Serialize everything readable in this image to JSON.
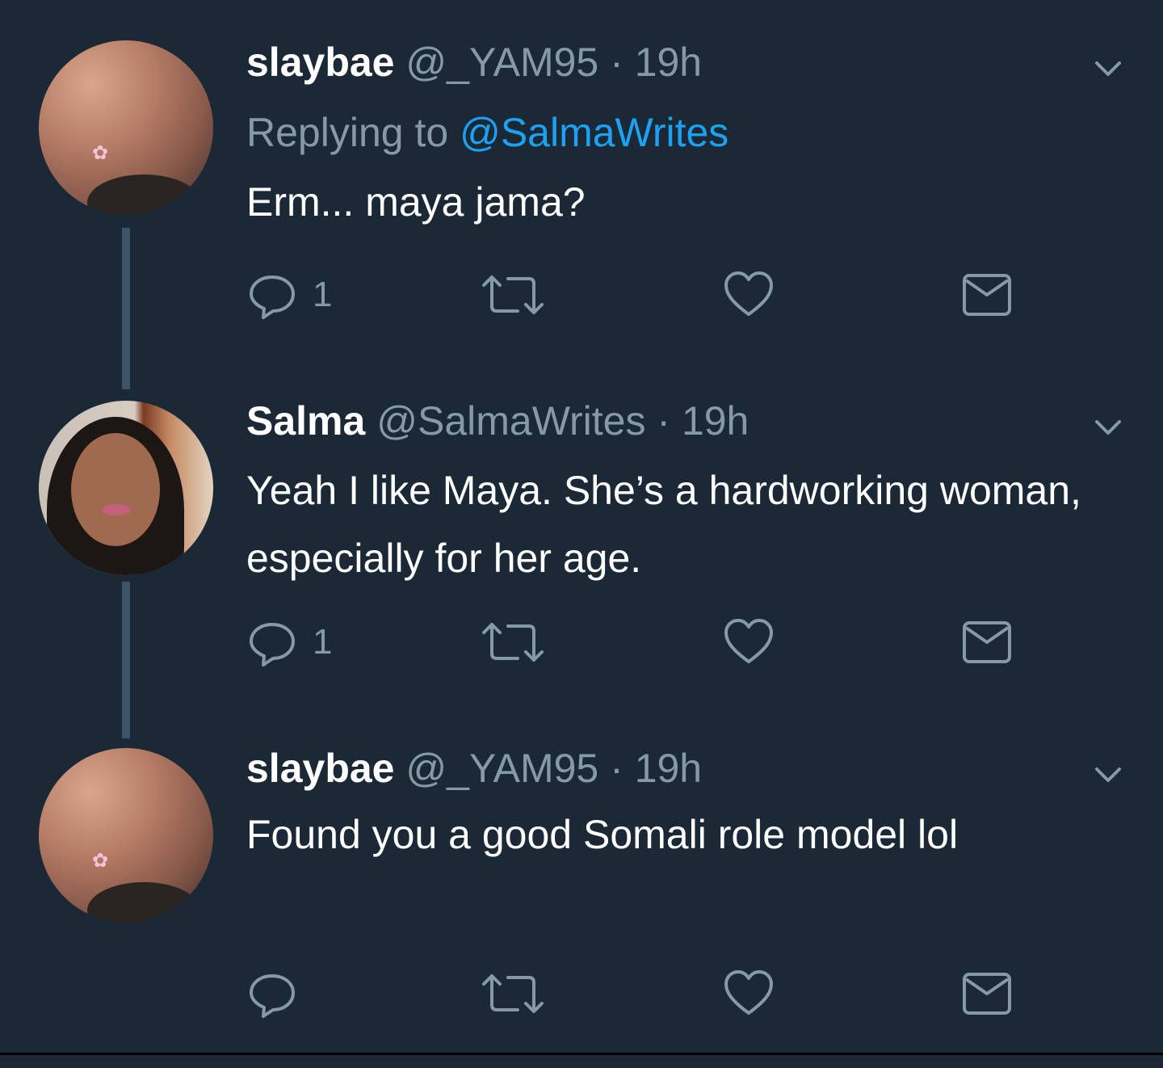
{
  "tweets": [
    {
      "name": "slaybae",
      "handle": "@_YAM95",
      "sep": "·",
      "time": "19h",
      "replying_prefix": "Replying to",
      "replying_to": "@SalmaWrites",
      "text": "Erm... maya jama?",
      "reply_count": "1"
    },
    {
      "name": "Salma",
      "handle": "@SalmaWrites",
      "sep": "·",
      "time": "19h",
      "text": "Yeah I like Maya. She’s a hardworking woman, especially for her age.",
      "reply_count": "1"
    },
    {
      "name": "slaybae",
      "handle": "@_YAM95",
      "sep": "·",
      "time": "19h",
      "text": "Found you a good Somali role model lol",
      "reply_count": ""
    }
  ],
  "icons": {
    "reply": "reply-icon",
    "retweet": "retweet-icon",
    "like": "heart-icon",
    "dm": "envelope-icon",
    "menu": "chevron-down-icon"
  },
  "colors": {
    "background": "#1b2836",
    "text": "#ffffff",
    "muted": "#8899a6",
    "link": "#1da1f2",
    "thread_line": "#3d5466"
  }
}
